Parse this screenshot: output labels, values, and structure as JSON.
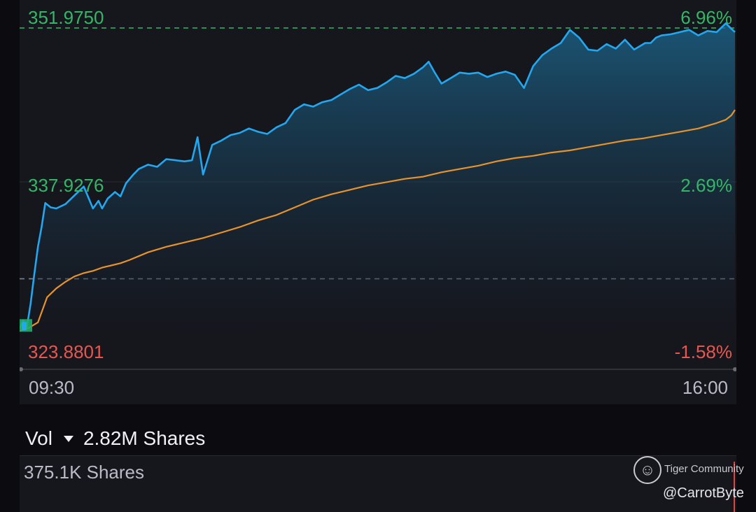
{
  "chart_data": {
    "type": "line",
    "title": "",
    "xlabel": "",
    "ylabel": "",
    "x_start": "09:30",
    "x_end": "16:00",
    "ylim": [
      323.8801,
      351.975
    ],
    "y_ticks": [
      "351.9750",
      "337.9276",
      "323.8801"
    ],
    "pct_ticks": [
      "6.96%",
      "2.69%",
      "-1.58%"
    ],
    "prev_close": 329.08,
    "series": [
      {
        "color": "#22a7f0",
        "fill": true,
        "x_minutes": [
          0,
          2,
          4,
          6,
          8,
          10,
          12,
          14,
          17,
          20,
          25,
          30,
          35,
          40,
          43,
          45,
          48,
          52,
          55,
          58,
          62,
          65,
          70,
          75,
          80,
          85,
          90,
          94,
          97,
          100,
          105,
          110,
          115,
          120,
          125,
          130,
          135,
          140,
          145,
          150,
          155,
          160,
          165,
          170,
          175,
          180,
          185,
          190,
          195,
          200,
          205,
          210,
          215,
          220,
          223,
          226,
          230,
          235,
          240,
          245,
          250,
          255,
          260,
          265,
          270,
          275,
          280,
          285,
          290,
          295,
          300,
          305,
          310,
          315,
          320,
          325,
          330,
          335,
          338,
          341,
          344,
          347,
          350,
          355,
          360,
          365,
          370,
          375,
          380,
          385,
          388,
          390
        ],
        "values": [
          324.5,
          325.3,
          324.7,
          326.8,
          329.5,
          332.0,
          333.8,
          336.0,
          335.6,
          335.5,
          335.9,
          336.7,
          337.5,
          335.5,
          336.2,
          335.5,
          336.4,
          337.0,
          336.6,
          337.8,
          338.6,
          339.1,
          339.5,
          339.3,
          340.0,
          339.9,
          339.8,
          339.9,
          342.0,
          338.6,
          341.3,
          341.7,
          342.2,
          342.4,
          342.8,
          342.5,
          342.3,
          342.9,
          343.3,
          344.5,
          345.0,
          344.8,
          345.2,
          345.4,
          345.9,
          346.4,
          346.8,
          346.3,
          346.5,
          347.0,
          347.6,
          347.4,
          347.8,
          348.4,
          348.9,
          348.0,
          346.9,
          347.4,
          347.9,
          347.8,
          347.9,
          347.5,
          347.8,
          348.0,
          347.7,
          346.5,
          348.5,
          349.5,
          350.1,
          350.6,
          351.8,
          351.1,
          350.0,
          349.9,
          350.5,
          350.1,
          350.9,
          350.0,
          350.3,
          350.6,
          350.6,
          351.1,
          351.3,
          351.4,
          351.6,
          351.8,
          351.3,
          351.7,
          351.6,
          352.4,
          351.9,
          351.6
        ]
      },
      {
        "color": "#e8922a",
        "fill": false,
        "x_minutes": [
          0,
          5,
          10,
          15,
          20,
          25,
          30,
          35,
          40,
          45,
          50,
          55,
          60,
          70,
          80,
          90,
          100,
          110,
          120,
          130,
          140,
          150,
          160,
          170,
          180,
          190,
          200,
          210,
          220,
          230,
          240,
          250,
          260,
          270,
          280,
          290,
          300,
          310,
          320,
          330,
          340,
          350,
          360,
          370,
          380,
          385,
          388,
          390
        ],
        "values": [
          324.3,
          324.6,
          325.1,
          327.4,
          328.2,
          328.8,
          329.3,
          329.6,
          329.8,
          330.1,
          330.3,
          330.5,
          330.8,
          331.5,
          332.0,
          332.4,
          332.8,
          333.3,
          333.8,
          334.4,
          334.9,
          335.6,
          336.3,
          336.8,
          337.2,
          337.6,
          337.9,
          338.2,
          338.4,
          338.8,
          339.1,
          339.4,
          339.8,
          340.1,
          340.3,
          340.6,
          340.8,
          341.1,
          341.4,
          341.7,
          341.9,
          342.2,
          342.5,
          342.8,
          343.3,
          343.6,
          344.0,
          344.5
        ]
      }
    ],
    "legend": "none",
    "grid": true
  },
  "axis": {
    "y_high": "351.9750",
    "y_mid": "337.9276",
    "y_low": "323.8801",
    "pct_high": "6.96%",
    "pct_mid": "2.69%",
    "pct_low": "-1.58%",
    "time_start": "09:30",
    "time_end": "16:00"
  },
  "colors": {
    "up": "#33b766",
    "down": "#e8574f",
    "price_line": "#22a7f0",
    "avg_line": "#e8922a",
    "panel_bg": "#16161d"
  },
  "volume": {
    "label": "Vol",
    "total": "2.82M Shares",
    "sub_value": "375.1K Shares"
  },
  "watermark": {
    "brand": "Tiger Community",
    "handle": "@CarrotByte"
  }
}
